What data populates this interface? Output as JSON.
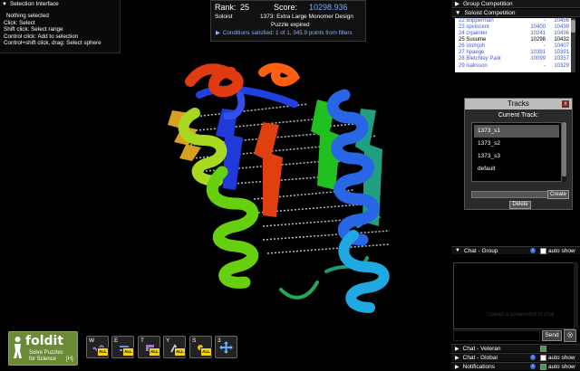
{
  "selection": {
    "title": "Selection Interface",
    "lines": [
      "Nothing selected",
      "Click: Select",
      "Shift click: Select range",
      "Control click: Add to selection",
      "Control+shift click, drag: Select sphere"
    ]
  },
  "score": {
    "rank_label": "Rank:",
    "rank": "25",
    "score_label": "Score:",
    "score": "10298.936",
    "mode": "Soloist",
    "puzzle": "1373: Extra Large Monomer Design",
    "status": "Puzzle expired",
    "conditions": "Conditions satisfied: 1 of 1, 345.9 points from filters"
  },
  "competition": {
    "group_label": "Group Competition",
    "soloist_label": "Soloist Competition",
    "rows": [
      {
        "name": "22 Blipperman",
        "a": "-",
        "b": "10456"
      },
      {
        "name": "23 spvincent",
        "a": "10400",
        "b": "10439"
      },
      {
        "name": "24 crpainter",
        "a": "10241",
        "b": "10436"
      },
      {
        "name": "25 Susume",
        "a": "10298",
        "b": "10432"
      },
      {
        "name": "26 stomjoh",
        "a": "-",
        "b": "10407"
      },
      {
        "name": "27 hpaege",
        "a": "10391",
        "b": "10391"
      },
      {
        "name": "28 Bletchley Park",
        "a": "10099",
        "b": "10357"
      },
      {
        "name": "29 isaksson",
        "a": "-",
        "b": "10329"
      }
    ]
  },
  "tracks": {
    "title": "Tracks",
    "close": "x",
    "current_label": "Current Track:",
    "items": [
      "1373_s1",
      "1373_s2",
      "1373_s3",
      "default"
    ],
    "create": "Create",
    "delete": "Delete"
  },
  "chat": {
    "group": "Chat - Group",
    "auto_show": "auto show",
    "info": "i",
    "placeholder": "Upload a screenshot to chat",
    "send": "Send",
    "veteran": "Chat - Veteran",
    "global": "Chat - Global",
    "notifications": "Notifications"
  },
  "logo": {
    "brand": "foldit",
    "tagline1": "Solve Puzzles",
    "tagline2": "for Science",
    "hotkey": "[H]"
  },
  "tools": [
    {
      "key": "W",
      "icon": "wiggle-icon",
      "badge": "ALL"
    },
    {
      "key": "E",
      "icon": "shake-icon",
      "badge": "ALL"
    },
    {
      "key": "T",
      "icon": "tweak-icon",
      "badge": "ALL"
    },
    {
      "key": "Y",
      "icon": "rebuild-icon",
      "badge": "ALL"
    },
    {
      "key": "S",
      "icon": "sidechain-icon",
      "badge": "ALL"
    },
    {
      "key": "3",
      "icon": "move-icon",
      "badge": ""
    }
  ],
  "colors": {
    "score_blue": "#7aa8ff",
    "link_blue": "#3b5bd6",
    "badge_yellow": "#f3d21f",
    "logo_green": "#6a8a36"
  }
}
